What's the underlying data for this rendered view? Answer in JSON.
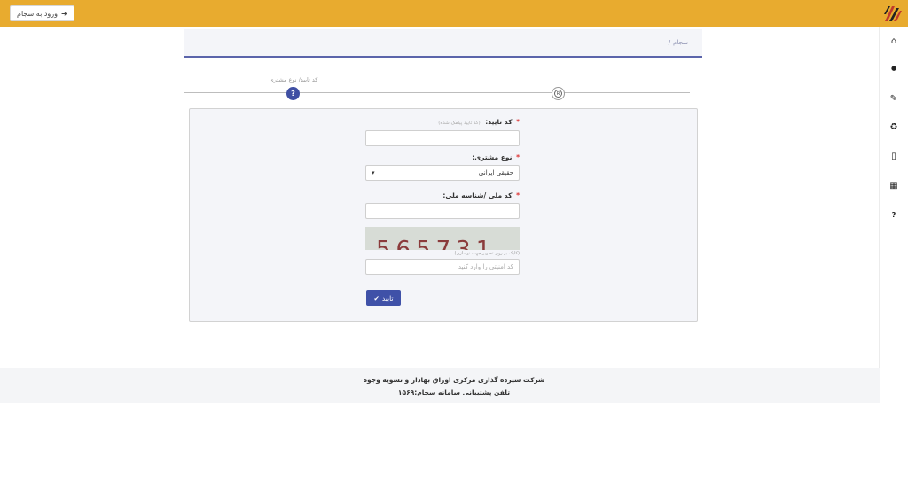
{
  "header": {
    "login_button_label": "ورود به سجام",
    "login_icon": "sign-in-icon",
    "accent_color": "#e8ab2f"
  },
  "sidebar": {
    "items": [
      {
        "icon": "home-icon",
        "glyph": "⌂"
      },
      {
        "icon": "user-icon",
        "glyph": "●"
      },
      {
        "icon": "edit-icon",
        "glyph": "✎"
      },
      {
        "icon": "recycle-icon",
        "glyph": "♻"
      },
      {
        "icon": "mobile-icon",
        "glyph": "▯"
      },
      {
        "icon": "building-icon",
        "glyph": "▦"
      },
      {
        "icon": "question-icon",
        "glyph": "?"
      }
    ]
  },
  "breadcrumb": {
    "items": [
      "سجام",
      "/"
    ]
  },
  "stepper": {
    "active_label": "کد تایید/ نوع مشتری",
    "active_symbol": "?",
    "idle_symbol": "R"
  },
  "form": {
    "verification": {
      "label": "کد تایید:",
      "hint": "(کد تایید پیامک شده)",
      "value": ""
    },
    "customer_type": {
      "label": "نوع مشتری:",
      "selected": "حقیقی ایرانی"
    },
    "national_id": {
      "label": "کد ملی /شناسه ملی:",
      "value": ""
    },
    "captcha": {
      "text": "565731",
      "hint": "(کلیک بر روی تصویر جهت نوسازی)",
      "input_placeholder": "کد امنیتی را وارد کنید"
    },
    "submit_label": "تایید",
    "required_mark": "*"
  },
  "footer": {
    "company": "شرکت سپرده گذاری مرکزی اوراق بهادار و تسویه وجوه",
    "support_phone": "تلفن پشتیبانی سامانه سجام:۱۵۶۹"
  }
}
